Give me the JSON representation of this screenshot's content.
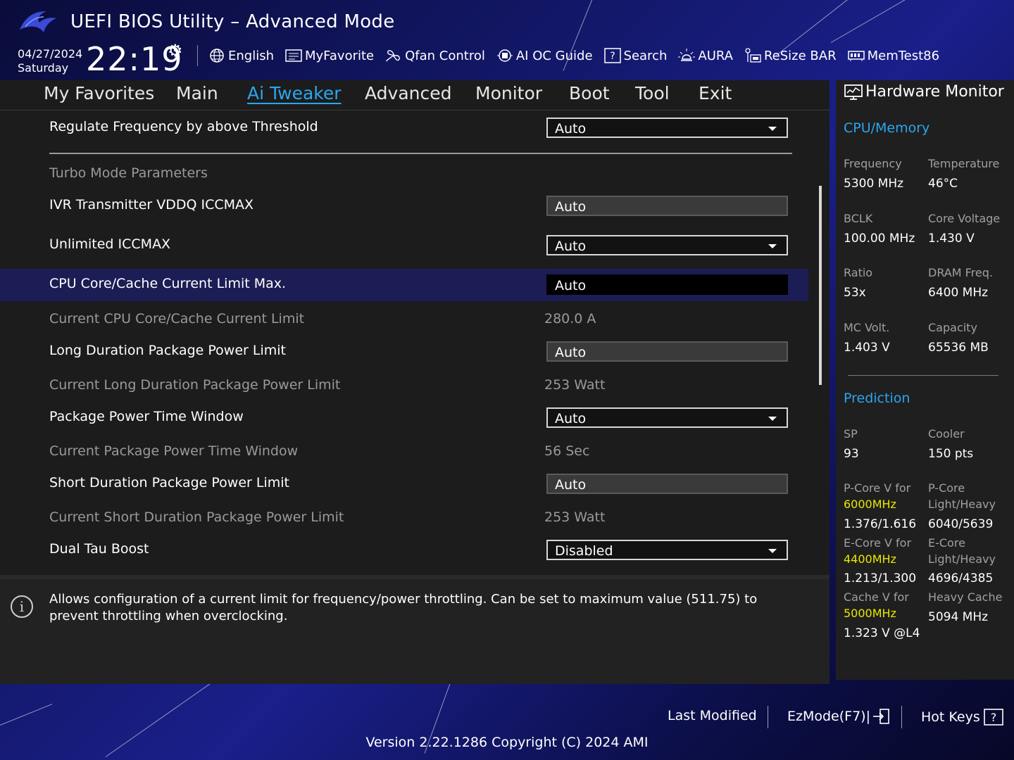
{
  "header": {
    "title": "UEFI BIOS Utility – Advanced Mode",
    "date": "04/27/2024",
    "day": "Saturday",
    "time": "22:19",
    "toolbar": [
      {
        "label": "English",
        "icon": "globe-icon"
      },
      {
        "label": "MyFavorite",
        "icon": "favorite-list-icon"
      },
      {
        "label": "Qfan Control",
        "icon": "fan-icon"
      },
      {
        "label": "AI OC Guide",
        "icon": "ai-chip-icon"
      },
      {
        "label": "Search",
        "icon": "help-search-icon"
      },
      {
        "label": "AURA",
        "icon": "aura-light-icon"
      },
      {
        "label": "ReSize BAR",
        "icon": "resize-bar-icon"
      },
      {
        "label": "MemTest86",
        "icon": "memory-icon"
      }
    ]
  },
  "tabs": [
    "My Favorites",
    "Main",
    "Ai Tweaker",
    "Advanced",
    "Monitor",
    "Boot",
    "Tool",
    "Exit"
  ],
  "active_tab": "Ai Tweaker",
  "settings": {
    "regulate_freq": {
      "label": "Regulate Frequency by above Threshold",
      "value": "Auto"
    },
    "section_header": "Turbo Mode Parameters",
    "ivr_vddq": {
      "label": "IVR Transmitter VDDQ ICCMAX",
      "value": "Auto"
    },
    "unlimited_iccmax": {
      "label": "Unlimited ICCMAX",
      "value": "Auto"
    },
    "cpu_core_cache_limit": {
      "label": "CPU Core/Cache Current Limit Max.",
      "value": "Auto"
    },
    "current_core_cache_limit": {
      "label": "Current CPU Core/Cache Current Limit",
      "value": "280.0 A"
    },
    "long_duration_limit": {
      "label": "Long Duration Package Power Limit",
      "value": "Auto"
    },
    "current_long_duration": {
      "label": "Current Long Duration Package Power Limit",
      "value": "253 Watt"
    },
    "package_time_window": {
      "label": "Package Power Time Window",
      "value": "Auto"
    },
    "current_time_window": {
      "label": "Current Package Power Time Window",
      "value": "56 Sec"
    },
    "short_duration_limit": {
      "label": "Short Duration Package Power Limit",
      "value": "Auto"
    },
    "current_short_duration": {
      "label": "Current Short Duration Package Power Limit",
      "value": "253 Watt"
    },
    "dual_tau_boost": {
      "label": "Dual Tau Boost",
      "value": "Disabled"
    }
  },
  "help_text": "Allows configuration of a current limit for frequency/power throttling. Can be set to maximum value (511.75) to prevent throttling when overclocking.",
  "hardware_monitor": {
    "title": "Hardware Monitor",
    "cpu_memory": {
      "heading": "CPU/Memory",
      "items": [
        {
          "label": "Frequency",
          "value": "5300 MHz"
        },
        {
          "label": "Temperature",
          "value": "46°C"
        },
        {
          "label": "BCLK",
          "value": "100.00 MHz"
        },
        {
          "label": "Core Voltage",
          "value": "1.430 V"
        },
        {
          "label": "Ratio",
          "value": "53x"
        },
        {
          "label": "DRAM Freq.",
          "value": "6400 MHz"
        },
        {
          "label": "MC Volt.",
          "value": "1.403 V"
        },
        {
          "label": "Capacity",
          "value": "65536 MB"
        }
      ]
    },
    "prediction": {
      "heading": "Prediction",
      "sp_label": "SP",
      "sp_value": "93",
      "cooler_label": "Cooler",
      "cooler_value": "150 pts",
      "pcore_v_label": "P-Core V for",
      "pcore_v_freq": "6000MHz",
      "pcore_v_value": "1.376/1.616",
      "pcore_lh_label1": "P-Core",
      "pcore_lh_label2": "Light/Heavy",
      "pcore_lh_value": "6040/5639",
      "ecore_v_label": "E-Core V for",
      "ecore_v_freq": "4400MHz",
      "ecore_v_value": "1.213/1.300",
      "ecore_lh_label1": "E-Core",
      "ecore_lh_label2": "Light/Heavy",
      "ecore_lh_value": "4696/4385",
      "cache_v_label": "Cache V for",
      "cache_v_freq": "5000MHz",
      "cache_v_value": "1.323 V @L4",
      "heavy_cache_label": "Heavy Cache",
      "heavy_cache_value": "5094 MHz"
    }
  },
  "footer": {
    "last_modified": "Last Modified",
    "ezmode": "EzMode(F7)|",
    "hotkeys": "Hot Keys",
    "version": "Version 2.22.1286 Copyright (C) 2024 AMI"
  },
  "colors": {
    "accent": "#2aa6f0",
    "highlight_row": "#1c1d55",
    "yellow": "#e8e800",
    "panel": "#1c1c1c"
  }
}
